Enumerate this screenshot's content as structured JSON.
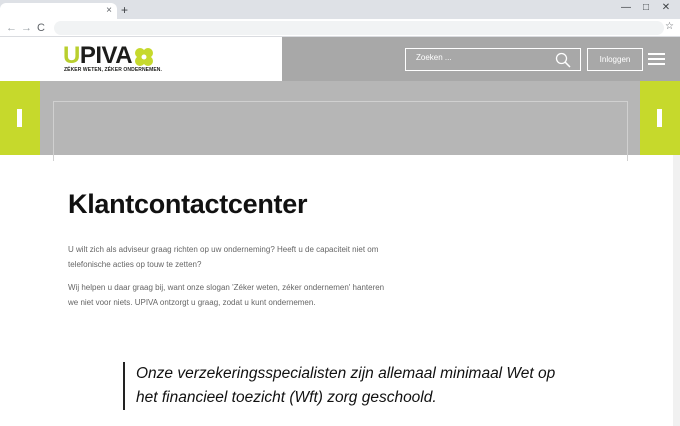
{
  "browser": {
    "tab_close": "×",
    "new_tab": "+",
    "win_minimize": "—",
    "win_maximize": "□",
    "win_close": "✕",
    "back": "←",
    "forward": "→",
    "reload": "C",
    "bookmark_star": "☆"
  },
  "header": {
    "logo_u": "U",
    "logo_rest": "PIVA",
    "logo_slogan": "ZÉKER WETEN, ZÉKER ONDERNEMEN.",
    "search_placeholder": "Zoeken ...",
    "login_label": "Inloggen",
    "colors": {
      "header_bg": "#a8a8a8",
      "brand_green": "#c6d92c"
    }
  },
  "hero": {
    "icons": [
      "previous-slide-icon",
      "next-slide-icon"
    ]
  },
  "content": {
    "title": "Klantcontactcenter",
    "paragraph1": "U wilt zich als adviseur graag richten op uw onderneming? Heeft u de capaciteit niet om telefonische acties op touw te zetten?",
    "paragraph2": "Wij helpen u daar graag bij, want onze slogan 'Zéker weten, zéker ondernemen' hanteren we niet voor niets. UPIVA ontzorgt u graag, zodat u kunt ondernemen.",
    "quote": "Onze verzekeringsspecialisten zijn allemaal minimaal Wet op het financieel toezicht (Wft) zorg geschoold."
  }
}
